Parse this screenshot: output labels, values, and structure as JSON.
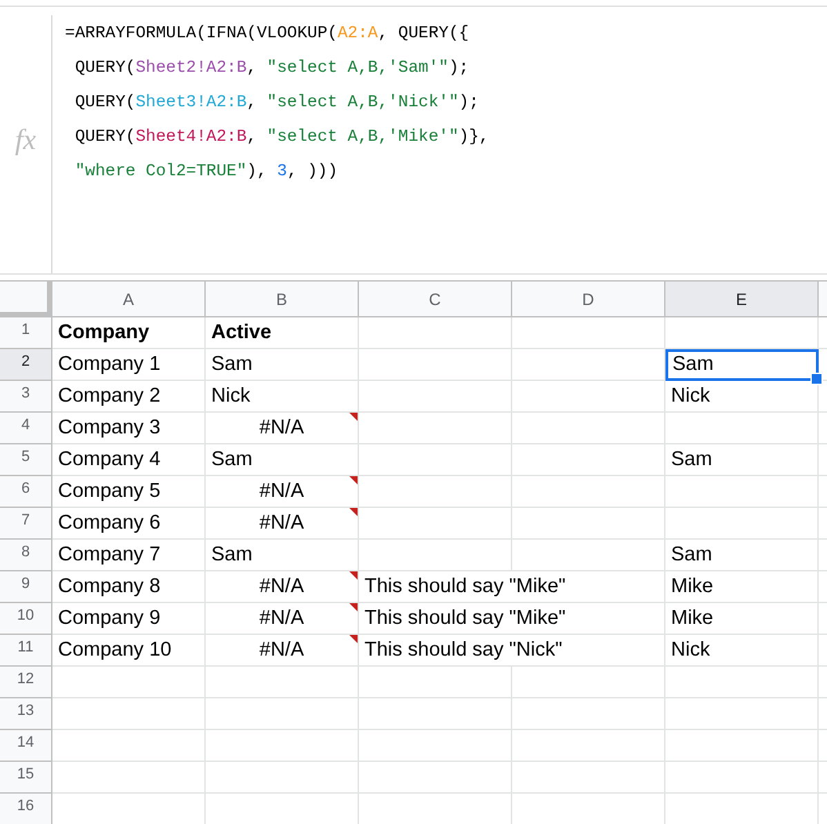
{
  "formula_bar": {
    "icon_label": "fx",
    "lines": [
      [
        {
          "kind": "plain",
          "text": "=ARRAYFORMULA(IFNA(VLOOKUP("
        },
        {
          "kind": "range1",
          "text": "A2:A"
        },
        {
          "kind": "plain",
          "text": ", QUERY({"
        }
      ],
      [
        {
          "kind": "plain",
          "text": " QUERY("
        },
        {
          "kind": "range2",
          "text": "Sheet2!A2:B"
        },
        {
          "kind": "plain",
          "text": ", "
        },
        {
          "kind": "string",
          "text": "\"select A,B,'Sam'\""
        },
        {
          "kind": "plain",
          "text": ");"
        }
      ],
      [
        {
          "kind": "plain",
          "text": " QUERY("
        },
        {
          "kind": "range3",
          "text": "Sheet3!A2:B"
        },
        {
          "kind": "plain",
          "text": ", "
        },
        {
          "kind": "string",
          "text": "\"select A,B,'Nick'\""
        },
        {
          "kind": "plain",
          "text": ");"
        }
      ],
      [
        {
          "kind": "plain",
          "text": " QUERY("
        },
        {
          "kind": "range4",
          "text": "Sheet4!A2:B"
        },
        {
          "kind": "plain",
          "text": ", "
        },
        {
          "kind": "string",
          "text": "\"select A,B,'Mike'\""
        },
        {
          "kind": "plain",
          "text": ")},"
        }
      ],
      [
        {
          "kind": "string",
          "text": " \"where Col2=TRUE\""
        },
        {
          "kind": "plain",
          "text": "), "
        },
        {
          "kind": "number",
          "text": "3"
        },
        {
          "kind": "plain",
          "text": ", )))"
        }
      ]
    ]
  },
  "sheet": {
    "columns": [
      {
        "label": "A",
        "selected": false
      },
      {
        "label": "B",
        "selected": false
      },
      {
        "label": "C",
        "selected": false
      },
      {
        "label": "D",
        "selected": false
      },
      {
        "label": "E",
        "selected": true
      }
    ],
    "rows": [
      {
        "number": "1",
        "selected": false,
        "cells": [
          {
            "text": "Company",
            "bold": true,
            "error": false,
            "selected": false
          },
          {
            "text": "Active",
            "bold": true,
            "error": false,
            "selected": false
          },
          {},
          {},
          {}
        ]
      },
      {
        "number": "2",
        "selected": true,
        "cells": [
          {
            "text": "Company 1",
            "bold": false,
            "error": false,
            "selected": false
          },
          {
            "text": "Sam",
            "bold": false,
            "error": false,
            "selected": false
          },
          {},
          {},
          {
            "text": "Sam",
            "bold": false,
            "error": false,
            "selected": true
          }
        ]
      },
      {
        "number": "3",
        "selected": false,
        "cells": [
          {
            "text": "Company 2",
            "bold": false,
            "error": false,
            "selected": false
          },
          {
            "text": "Nick",
            "bold": false,
            "error": false,
            "selected": false
          },
          {},
          {},
          {
            "text": "Nick",
            "bold": false,
            "error": false,
            "selected": false
          }
        ]
      },
      {
        "number": "4",
        "selected": false,
        "cells": [
          {
            "text": "Company 3",
            "bold": false,
            "error": false,
            "selected": false
          },
          {
            "text": "#N/A",
            "bold": false,
            "error": true,
            "selected": false
          },
          {},
          {},
          {}
        ]
      },
      {
        "number": "5",
        "selected": false,
        "cells": [
          {
            "text": "Company 4",
            "bold": false,
            "error": false,
            "selected": false
          },
          {
            "text": "Sam",
            "bold": false,
            "error": false,
            "selected": false
          },
          {},
          {},
          {
            "text": "Sam",
            "bold": false,
            "error": false,
            "selected": false
          }
        ]
      },
      {
        "number": "6",
        "selected": false,
        "cells": [
          {
            "text": "Company 5",
            "bold": false,
            "error": false,
            "selected": false
          },
          {
            "text": "#N/A",
            "bold": false,
            "error": true,
            "selected": false
          },
          {},
          {},
          {}
        ]
      },
      {
        "number": "7",
        "selected": false,
        "cells": [
          {
            "text": "Company 6",
            "bold": false,
            "error": false,
            "selected": false
          },
          {
            "text": "#N/A",
            "bold": false,
            "error": true,
            "selected": false
          },
          {},
          {},
          {}
        ]
      },
      {
        "number": "8",
        "selected": false,
        "cells": [
          {
            "text": "Company 7",
            "bold": false,
            "error": false,
            "selected": false
          },
          {
            "text": "Sam",
            "bold": false,
            "error": false,
            "selected": false
          },
          {},
          {},
          {
            "text": "Sam",
            "bold": false,
            "error": false,
            "selected": false
          }
        ]
      },
      {
        "number": "9",
        "selected": false,
        "cells": [
          {
            "text": "Company 8",
            "bold": false,
            "error": false,
            "selected": false
          },
          {
            "text": "#N/A",
            "bold": false,
            "error": true,
            "selected": false
          },
          {
            "text": "This should say \"Mike\"",
            "bold": false,
            "error": false,
            "selected": false
          },
          {},
          {
            "text": "Mike",
            "bold": false,
            "error": false,
            "selected": false
          }
        ]
      },
      {
        "number": "10",
        "selected": false,
        "cells": [
          {
            "text": "Company 9",
            "bold": false,
            "error": false,
            "selected": false
          },
          {
            "text": "#N/A",
            "bold": false,
            "error": true,
            "selected": false
          },
          {
            "text": "This should say \"Mike\"",
            "bold": false,
            "error": false,
            "selected": false
          },
          {},
          {
            "text": "Mike",
            "bold": false,
            "error": false,
            "selected": false
          }
        ]
      },
      {
        "number": "11",
        "selected": false,
        "cells": [
          {
            "text": "Company 10",
            "bold": false,
            "error": false,
            "selected": false
          },
          {
            "text": "#N/A",
            "bold": false,
            "error": true,
            "selected": false
          },
          {
            "text": "This should say \"Nick\"",
            "bold": false,
            "error": false,
            "selected": false
          },
          {},
          {
            "text": "Nick",
            "bold": false,
            "error": false,
            "selected": false
          }
        ]
      },
      {
        "number": "12",
        "selected": false
      },
      {
        "number": "13",
        "selected": false
      },
      {
        "number": "14",
        "selected": false
      },
      {
        "number": "15",
        "selected": false
      },
      {
        "number": "16",
        "selected": false
      }
    ]
  }
}
